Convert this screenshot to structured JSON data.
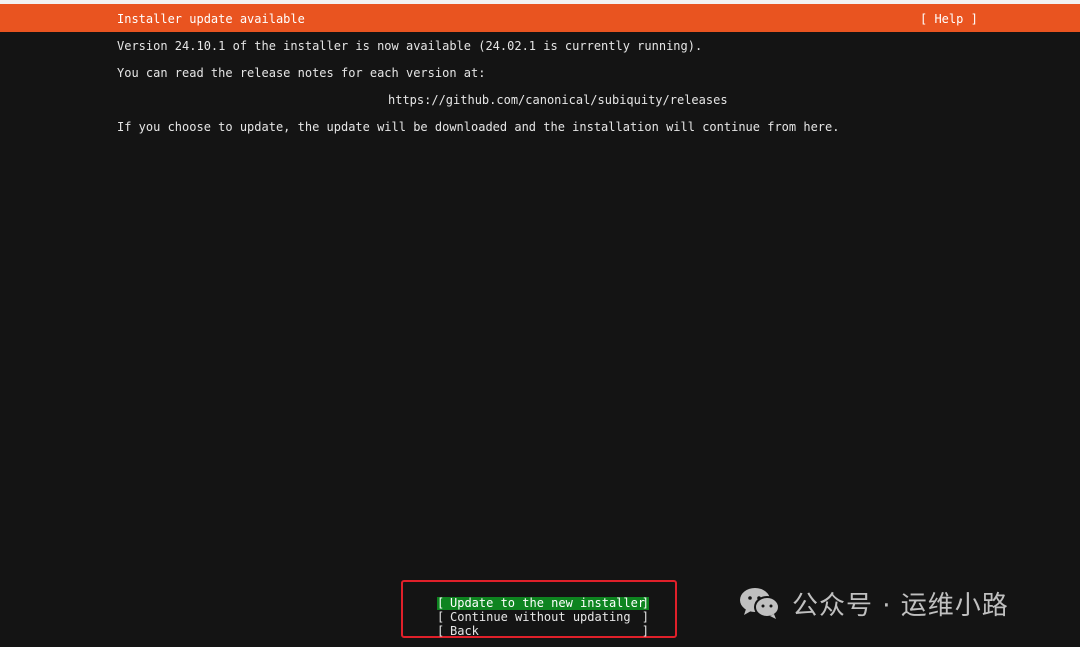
{
  "header": {
    "title": "Installer update available",
    "help_label": "[ Help ]"
  },
  "body": {
    "line1": "Version 24.10.1 of the installer is now available (24.02.1 is currently running).",
    "line2": "You can read the release notes for each version at:",
    "url": "https://github.com/canonical/subiquity/releases",
    "line3": "If you choose to update, the update will be downloaded and the installation will continue from here."
  },
  "buttons": {
    "bracket_left": "[",
    "bracket_right": "]",
    "update": "Update to the new installer",
    "continue": "Continue without updating",
    "back": "Back"
  },
  "watermark": {
    "text": "公众号 · 运维小路",
    "icon": "wechat-icon"
  },
  "colors": {
    "header_bg": "#e95420",
    "selected_button_bg": "#0e8420",
    "highlight_border": "#e0202a",
    "background": "#141414"
  }
}
